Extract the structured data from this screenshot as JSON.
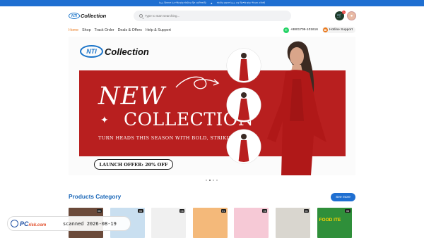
{
  "topbar": {
    "announcements": [
      "৳৯৯ কিনলে ৳৫০% ছাড় অর্ডারে ফ্রি ডেলিভারি",
      "অর্ডার করলে ৳৯৯ এর বিশেষ ছাড় পাবেন এখনই"
    ]
  },
  "header": {
    "logo_mark": "NTI",
    "logo_text": "Collection",
    "search_placeholder": "Type to start searching...",
    "cart_count": "0"
  },
  "nav": {
    "items": [
      "Home",
      "Shop",
      "Track Order",
      "Deals & Offers",
      "Help & Support"
    ],
    "active": "Home",
    "phone": "+8801709-101616",
    "hotline": "Hotline Support"
  },
  "banner": {
    "logo_mark": "NTI",
    "logo_text": "Collection",
    "headline1": "NEW",
    "headline2": "COLLECTION",
    "tagline": "TURN HEADS THIS SEASON WITH BOLD, STRIKING RED.",
    "offer": "LAUNCH OFFER: 20% OFF",
    "dots": 4,
    "active_dot": 1
  },
  "products_category": {
    "title": "Products Category",
    "see_more": "See more",
    "categories": [
      {
        "badge": "06",
        "color": "#6b4a3a"
      },
      {
        "badge": "06",
        "color": "#c9dff0"
      },
      {
        "badge": "06",
        "color": "#f0f0f0"
      },
      {
        "badge": "01",
        "color": "#f4b97a"
      },
      {
        "badge": "06",
        "color": "#f6c9d6"
      },
      {
        "badge": "06",
        "color": "#d9d6cf"
      },
      {
        "badge": "06",
        "color": "#2f8f3a",
        "label": "FOOD ITE"
      }
    ]
  },
  "watermark": {
    "brand": "PC",
    "brand_suffix": "risk.com",
    "scan": "scanned 2026-08-19"
  },
  "colors": {
    "primary": "#1f6fd1",
    "accent": "#ea7a1e",
    "banner_red": "#b81f1f"
  }
}
